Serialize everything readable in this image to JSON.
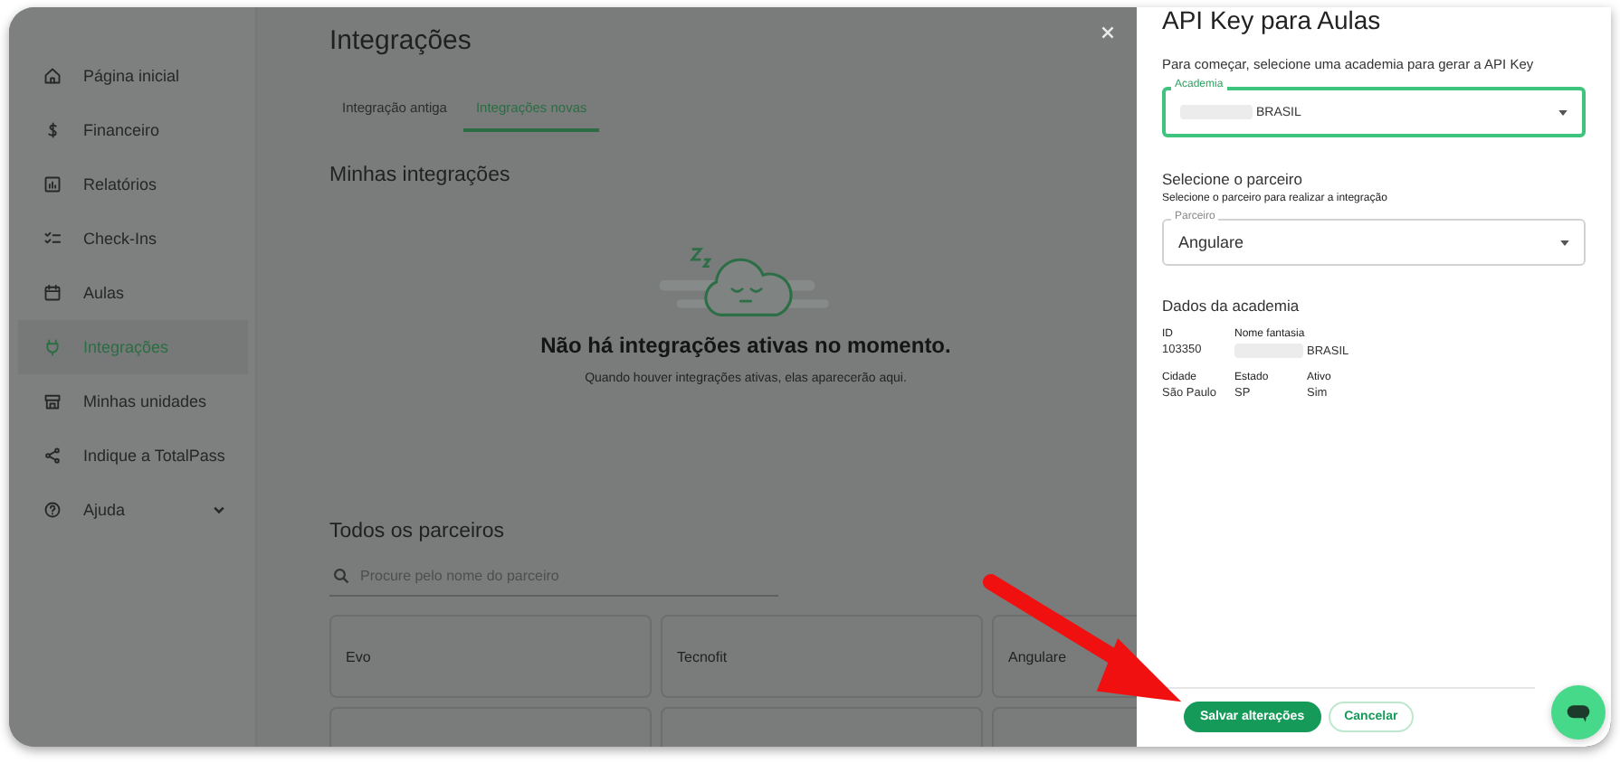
{
  "sidebar": {
    "items": [
      {
        "label": "Página inicial",
        "kind": "home",
        "selected": false
      },
      {
        "label": "Financeiro",
        "kind": "dollar",
        "selected": false
      },
      {
        "label": "Relatórios",
        "kind": "report",
        "selected": false
      },
      {
        "label": "Check-Ins",
        "kind": "checklist",
        "selected": false
      },
      {
        "label": "Aulas",
        "kind": "calendar",
        "selected": false
      },
      {
        "label": "Integrações",
        "kind": "plug",
        "selected": true
      },
      {
        "label": "Minhas unidades",
        "kind": "store",
        "selected": false
      },
      {
        "label": "Indique a TotalPass",
        "kind": "share",
        "selected": false
      },
      {
        "label": "Ajuda",
        "kind": "help",
        "selected": false,
        "expandable": true
      }
    ]
  },
  "main": {
    "title": "Integrações",
    "tabs": [
      {
        "label": "Integração antiga",
        "selected": false
      },
      {
        "label": "Integrações novas",
        "selected": true
      }
    ],
    "my_integrations": {
      "heading": "Minhas integrações",
      "empty_title": "Não há integrações ativas no momento.",
      "empty_text": "Quando houver integrações ativas, elas aparecerão aqui."
    },
    "partners": {
      "heading": "Todos os parceiros",
      "search": {
        "placeholder": "Procure pelo nome do parceiro"
      },
      "cards": [
        {
          "name": "Evo"
        },
        {
          "name": "Tecnofit"
        },
        {
          "name": "Angulare"
        }
      ]
    }
  },
  "drawer": {
    "title": "API Key para Aulas",
    "intro": "Para começar, selecione uma academia para gerar a API Key",
    "academy_field": {
      "label": "Academia",
      "value": "BRASIL",
      "redacted": true,
      "focused": true
    },
    "partner_section": {
      "heading": "Selecione o parceiro",
      "hint": "Selecione o parceiro para realizar a integração"
    },
    "partner_field": {
      "label": "Parceiro",
      "value": "Angulare",
      "focused": false
    },
    "details": {
      "heading": "Dados da academia",
      "rows": [
        [
          {
            "label": "ID",
            "value": "103350"
          },
          {
            "label": "Nome fantasia",
            "value": "BRASIL",
            "redacted": true
          }
        ],
        [
          {
            "label": "Cidade",
            "value": "São Paulo"
          },
          {
            "label": "Estado",
            "value": "SP"
          },
          {
            "label": "Ativo",
            "value": "Sim"
          }
        ]
      ]
    },
    "buttons": [
      {
        "label": "Salvar alterações",
        "kind": "primary"
      },
      {
        "label": "Cancelar",
        "kind": "secondary"
      }
    ]
  }
}
